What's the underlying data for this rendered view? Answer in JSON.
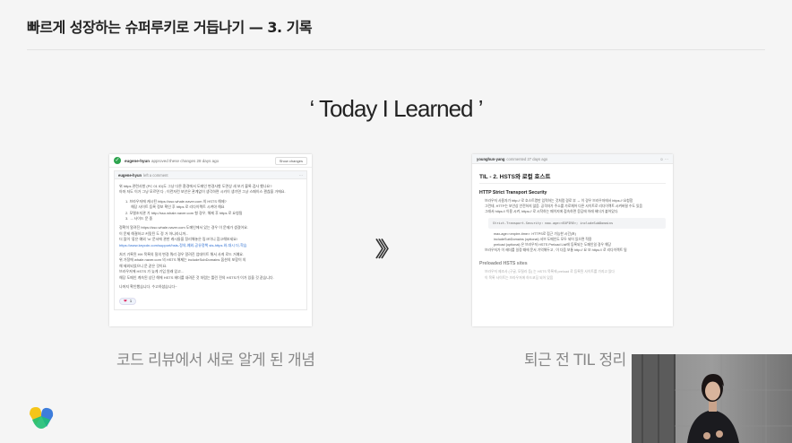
{
  "slide": {
    "title": "빠르게 성장하는 슈퍼루키로 거듭나기 — 3. 기록",
    "heading": "‘ Today I Learned ’"
  },
  "left_card": {
    "header": {
      "user": "eugene-hyun",
      "action": "approved these changes 28 days ago",
      "button": "Show changes"
    },
    "comment_head": {
      "user": "eugene-hyun",
      "meta": "left a comment"
    },
    "lines": [
      {
        "text": "위 https 관련사항 (PC 01 ID)도 그냥 다른 환경에서 도메인 변경사항 도면상 새 보기 블록 검사 했나요?",
        "style": ""
      },
      {
        "text": "아마 저도 이거 그냥 모르면 다 ; 이런저런 보안은 관계없이 생각하면 시키이 생기면 그냥 스페이스 괜찮을 거에요. ",
        "style": ""
      },
      {
        "text": "",
        "style": "gap"
      },
      {
        "text": "1. 브라우저에 캐시된 https://sso.whale.naver.com 의 HSTS 해제?",
        "style": "indent"
      },
      {
        "text": "해당 사이트 등록 정보 확인 후 https 로 리다이렉트 시켜야 해요 ",
        "style": "indent2"
      },
      {
        "text": "2. 모델조지관 가 http://sso.whale.naver.com 형 경우, 해제 후 https 로 요청됨",
        "style": "indent"
      },
      {
        "text": "3. → 사이드 문 중",
        "style": "indent"
      },
      {
        "text": "",
        "style": "gap"
      },
      {
        "text": "정확히 알려진 https://sso.whale.naver.com 도메인에서 있는 경우 이 문제가 생겼어요.",
        "style": ""
      },
      {
        "text": "이 문제 해결하고 커밋된 도 정 거 아니라니까...",
        "style": ""
      },
      {
        "text": "더 많이 '좋은 예외 '\\n' 문서에 관한 캐시들을 정리해놓은 링크이니 참고해보세요!",
        "style": ""
      },
      {
        "text": "https://www.keycdn.com/support/hsts-정의-예외-공유정책 sts-https 와-대시 더-학습",
        "style": "link"
      },
      {
        "text": "",
        "style": "gap"
      },
      {
        "text": "처기 기록된 HH 목록의 질의 변경 쿼리 경우 알려진 업데이트 해서 사게 로드 거예요.",
        "style": ""
      },
      {
        "text": "위 가정에 whale.naver.com 의 HSTS 해제는 includeSubDomains 옵션의 포함이 의",
        "style": ""
      },
      {
        "text": "해 제외되었으니 문 같은 것이요.",
        "style": ""
      },
      {
        "text": "브라우저에 HSTS 가 늦게 기입 원래 있고...",
        "style": ""
      },
      {
        "text": "해당 도메인 계속된 상단 해에 HSTS 헤더를 내려준 것 처럼는 틀린 전의 HSTS가 이가 있을 것 같습니다.",
        "style": ""
      },
      {
        "text": "",
        "style": "gap"
      },
      {
        "text": "나머지 확인했습니다. 수고하셨습니다~",
        "style": ""
      }
    ],
    "reaction": {
      "icon": "heart",
      "count": "1"
    }
  },
  "right_card": {
    "header": {
      "user": "younghun-yang",
      "meta": "commented 27 days ago"
    },
    "title": "TIL - 2. HSTS와 로컬 호스트",
    "section1": "HTTP Strict Transport Security",
    "bullets": [
      {
        "text": "브라우저 사용자가 http:// 로 호스트명만 입력하는 것처럼 경로 부 → 이 경우 브라우저에서 https:// 요청함",
        "sub": false
      },
      {
        "text": "그런데, HTTP는 보안상 안전하지 않음. 공격자가 주소를 가로채어 다른 사이트로 리다이렉트 시켜버릴 수도 있음",
        "sub": false
      },
      {
        "text": "그래서 https:// 이용 시켜, https:// 로 시작하는 페이지에 접속하면 응답에 아래 헤더가 붙어있다.",
        "sub": false
      }
    ],
    "code": "Strict-Transport-Security: max-age=<EXPIRE>; includeSubDomains",
    "sub_bullets": [
      {
        "text": "max-age=<expire-time>: HTTPS로 접근 가능한 시간(초)",
        "sub": true
      },
      {
        "text": "includeSubDomains (optional) 서브 도메인도 모두 되어 있으면 적용",
        "sub": true
      },
      {
        "text": "preload (optional) 은 브라우저 HSTS Preload List에 등록되는 도메인일 경우 해당",
        "sub": true
      },
      {
        "text": "브라우저가 이 헤더를 일정 때에 문서 기억해두고 , 이 다음 보통 http:// 요 또 https:// 로 리다이렉트 됨",
        "sub": false
      }
    ],
    "section2": "Preloaded HSTS sites",
    "faded_bullets": [
      "브라우저 제조사 (구글, 모질라 등) 는 HSTS 목록에 preload 로 등록된 사이트를 가지고 있다",
      "이 목록 사이트는 브라우저에 하드코딩 되어 있음"
    ]
  },
  "arrows": "〉〉〉",
  "captions": {
    "left": "코드 리뷰에서 새로 알게 된 개념",
    "right": "퇴근 전 TIL 정리"
  },
  "colors": {
    "accent_green": "#2da44e",
    "link_blue": "#2f6fd1",
    "logo_yellow": "#f5c518",
    "logo_green": "#1fbf75",
    "logo_blue": "#3d7ddb"
  }
}
